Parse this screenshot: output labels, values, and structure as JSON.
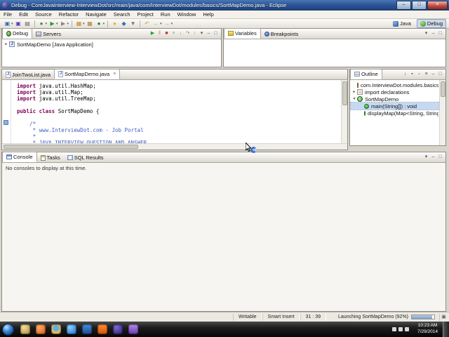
{
  "colors": {
    "titlebar": "#2c5699",
    "keyword": "#7f0055",
    "comment": "#3f5fbf",
    "selection": "#c6d9f0",
    "taskbar": "#1c1c1c"
  },
  "window": {
    "title": "Debug - CoreJavaInterview-InterviewDot/src/main/java/com/InterviewDot/modules/basics/SortMapDemo.java - Eclipse",
    "minimize": "–",
    "maximize": "□",
    "close": "×"
  },
  "menubar": {
    "items": [
      "File",
      "Edit",
      "Source",
      "Refactor",
      "Navigate",
      "Search",
      "Project",
      "Run",
      "Window",
      "Help"
    ]
  },
  "toolbar": {
    "items": [
      {
        "name": "new-wizard-icon",
        "glyph": "▣",
        "color": "#3a6ab5",
        "dd": true
      },
      {
        "name": "save-icon",
        "glyph": "▣",
        "color": "#5a3ab5"
      },
      {
        "name": "print-icon",
        "glyph": "▤",
        "color": "#666666"
      },
      {
        "sep": true
      },
      {
        "name": "debug-icon",
        "glyph": "●",
        "color": "#3a8a3a",
        "dd": true
      },
      {
        "name": "run-icon",
        "glyph": "▶",
        "color": "#2f9b2f",
        "dd": true
      },
      {
        "name": "external-tools-icon",
        "glyph": "▶",
        "color": "#888888",
        "dd": true
      },
      {
        "sep": true
      },
      {
        "name": "new-java-project-icon",
        "glyph": "▦",
        "color": "#c9892a",
        "dd": true
      },
      {
        "name": "new-package-icon",
        "glyph": "▦",
        "color": "#b5813a"
      },
      {
        "name": "new-class-icon",
        "glyph": "●",
        "color": "#2f7b2f",
        "dd": true
      },
      {
        "sep": true
      },
      {
        "name": "search-icon",
        "glyph": "●",
        "color": "#e0b52a"
      },
      {
        "name": "open-type-icon",
        "glyph": "◆",
        "color": "#3a6ab5"
      },
      {
        "name": "mark-occurrences-icon",
        "glyph": "▼",
        "color": "#777777"
      },
      {
        "sep": true
      },
      {
        "name": "last-edit-location-icon",
        "glyph": "↶",
        "color": "#c9a23a"
      },
      {
        "name": "back-icon",
        "glyph": "←",
        "color": "#c9a23a",
        "dd": true
      },
      {
        "name": "forward-icon",
        "glyph": "→",
        "color": "#c9a23a",
        "dd": true
      }
    ]
  },
  "perspectives": {
    "items": [
      {
        "label": "Java",
        "active": false
      },
      {
        "label": "Debug",
        "active": true
      }
    ]
  },
  "debug_view": {
    "tabs": [
      {
        "label": "Debug",
        "active": true
      },
      {
        "label": "Servers",
        "active": false
      }
    ],
    "toolbar": [
      {
        "name": "resume-icon",
        "glyph": "▶",
        "color": "#2f9b2f"
      },
      {
        "name": "suspend-icon",
        "glyph": "‖",
        "color": "#d48a2a"
      },
      {
        "name": "terminate-icon",
        "glyph": "■",
        "color": "#c0392b"
      },
      {
        "name": "disconnect-icon",
        "glyph": "×",
        "color": "#888888"
      },
      {
        "name": "step-into-icon",
        "glyph": "↓",
        "color": "#b08a2a"
      },
      {
        "name": "step-over-icon",
        "glyph": "↷",
        "color": "#b08a2a"
      },
      {
        "name": "step-return-icon",
        "glyph": "↑",
        "color": "#b08a2a"
      },
      {
        "name": "view-menu-icon",
        "glyph": "▾",
        "color": "#555555"
      },
      {
        "name": "minimize-view-icon",
        "glyph": "–",
        "color": "#555555"
      },
      {
        "name": "maximize-view-icon",
        "glyph": "□",
        "color": "#555555"
      }
    ],
    "tree": [
      {
        "label": "SortMapDemo [Java Application]",
        "icon": "java-application-icon",
        "arrow": "►",
        "indent": 0,
        "selected": false
      }
    ]
  },
  "variables_view": {
    "tabs": [
      {
        "label": "Variables",
        "active": true
      },
      {
        "label": "Breakpoints",
        "active": false
      }
    ],
    "toolbar": [
      {
        "name": "view-menu-icon",
        "glyph": "▾",
        "color": "#555555"
      },
      {
        "name": "minimize-view-icon",
        "glyph": "–",
        "color": "#555555"
      },
      {
        "name": "maximize-view-icon",
        "glyph": "□",
        "color": "#555555"
      }
    ]
  },
  "editor": {
    "tabs": [
      {
        "label": "JoinTwoList.java",
        "active": false
      },
      {
        "label": "SortMapDemo.java",
        "active": true,
        "close": "×"
      }
    ],
    "code": [
      [
        {
          "t": "import",
          "c": "kw"
        },
        {
          "t": " java.util.HashMap;"
        }
      ],
      [
        {
          "t": "import",
          "c": "kw"
        },
        {
          "t": " java.util.Map;"
        }
      ],
      [
        {
          "t": "import",
          "c": "kw"
        },
        {
          "t": " java.util.TreeMap;"
        }
      ],
      [],
      [
        {
          "t": "public",
          "c": "kw"
        },
        {
          "t": " "
        },
        {
          "t": "class",
          "c": "kw"
        },
        {
          "t": " SortMapDemo {"
        }
      ],
      [],
      [
        {
          "t": "    /*",
          "c": "cm"
        }
      ],
      [
        {
          "t": "     * www.InterviewDot.com - Job Portal",
          "c": "cm"
        }
      ],
      [
        {
          "t": "     *",
          "c": "cm"
        }
      ],
      [
        {
          "t": "     * JAVA INTERVIEW QUESTION AND ANSWER",
          "c": "cm"
        }
      ]
    ]
  },
  "outline": {
    "tab_label": "Outline",
    "toolbar": [
      {
        "name": "sort-icon",
        "glyph": "↓",
        "color": "#555555"
      },
      {
        "name": "hide-fields-icon",
        "glyph": "▪",
        "color": "#555555"
      },
      {
        "name": "hide-static-icon",
        "glyph": "▫",
        "color": "#555555"
      },
      {
        "name": "hide-non-public-icon",
        "glyph": "≡",
        "color": "#555555"
      },
      {
        "name": "minimize-view-icon",
        "glyph": "–",
        "color": "#555555"
      },
      {
        "name": "maximize-view-icon",
        "glyph": "□",
        "color": "#555555"
      }
    ],
    "tree": [
      {
        "label": "com.InterviewDot.modules.basics",
        "icon": "package-icon",
        "arrow": "",
        "indent": 0,
        "selected": false
      },
      {
        "label": "import declarations",
        "icon": "import-icon",
        "arrow": "►",
        "indent": 0,
        "selected": false
      },
      {
        "label": "SortMapDemo",
        "icon": "class-icon",
        "arrow": "▼",
        "indent": 0,
        "selected": false
      },
      {
        "label": "main(String[]) : void",
        "icon": "method-public-icon",
        "arrow": "",
        "indent": 1,
        "selected": true
      },
      {
        "label": "displayMap(Map<String, String",
        "icon": "method-public-icon",
        "arrow": "",
        "indent": 1,
        "selected": false
      }
    ]
  },
  "console_view": {
    "tabs": [
      {
        "label": "Console",
        "active": true
      },
      {
        "label": "Tasks",
        "active": false
      },
      {
        "label": "SQL Results",
        "active": false
      }
    ],
    "toolbar": [
      {
        "name": "view-menu-icon",
        "glyph": "▾",
        "color": "#555555"
      },
      {
        "name": "minimize-view-icon",
        "glyph": "–",
        "color": "#555555"
      },
      {
        "name": "maximize-view-icon",
        "glyph": "□",
        "color": "#555555"
      }
    ],
    "message": "No consoles to display at this time."
  },
  "statusbar": {
    "writable": "Writable",
    "insert_mode": "Smart Insert",
    "cursor_position": "31 : 39",
    "progress_label": "Launching SortMapDemo (92%)",
    "progress_percent": 92
  },
  "taskbar": {
    "icons": [
      {
        "name": "windows-explorer-icon",
        "color": "radial-gradient(circle at 35% 30%, #f0e0a0, #b08830)"
      },
      {
        "name": "firefox-icon",
        "color": "radial-gradient(circle at 35% 30%, #ffb070, #d45500)"
      },
      {
        "name": "chrome-icon",
        "color": "radial-gradient(circle at 50% 40%, #6aa8e8 30%, #e8d44a 60%, #d45540 85%)"
      },
      {
        "name": "internet-explorer-icon",
        "color": "radial-gradient(circle at 35% 30%, #8ad0ff, #1a6ad4)"
      },
      {
        "name": "media-player-icon",
        "color": "linear-gradient(#4a90d9,#1a4a9a)"
      },
      {
        "name": "vlc-icon",
        "color": "linear-gradient(#ff8a3a,#d45500)"
      },
      {
        "name": "eclipse-icon",
        "color": "radial-gradient(circle at 35% 30%, #7a6ad0, #2a1a6e)"
      },
      {
        "name": "screen-recorder-icon",
        "color": "linear-gradient(#b58ae8,#6a3ab5)"
      }
    ],
    "tray_icons": [
      "action-center-icon",
      "network-icon",
      "volume-icon"
    ],
    "clock_time": "10:23 AM",
    "clock_date": "7/29/2014"
  }
}
